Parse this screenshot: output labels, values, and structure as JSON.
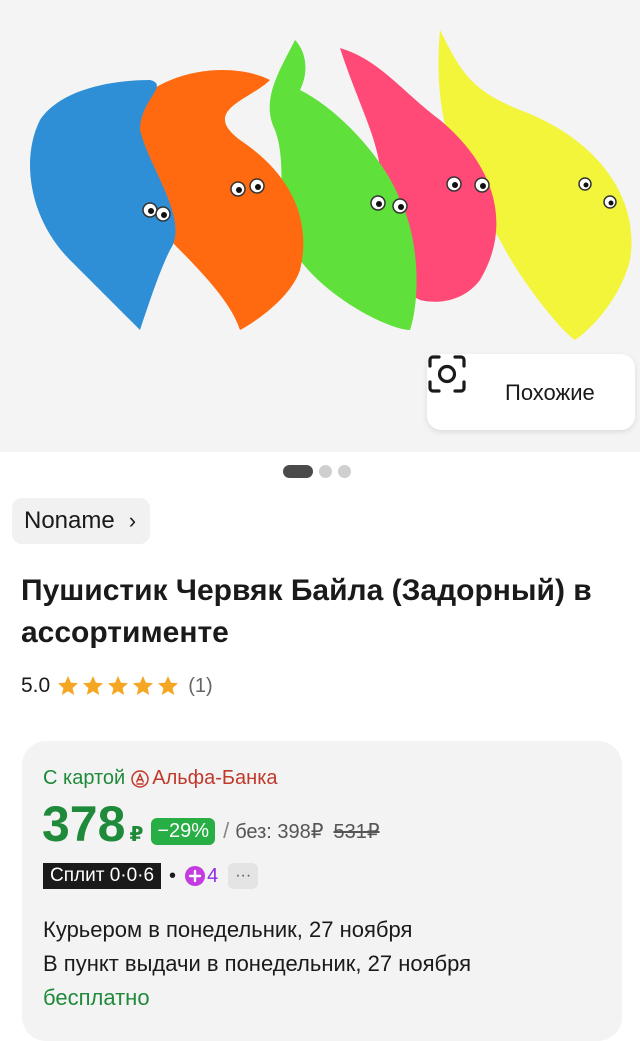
{
  "gallery": {
    "similar_label": "Похожие",
    "slides": 3,
    "active_slide": 1,
    "worm_colors": [
      "#2f8fd6",
      "#ff6a10",
      "#5fe03a",
      "#ff4a78",
      "#f2f53a"
    ]
  },
  "brand": {
    "name": "Noname"
  },
  "product": {
    "title": "Пушистик Червяк Байла (Задорный) в ассортименте",
    "rating": "5.0",
    "stars": 5,
    "reviews": "(1)"
  },
  "price_card": {
    "with_card": "С картой",
    "bank": "Альфа-Банка",
    "price": "378",
    "currency": "₽",
    "discount": "−29%",
    "without_card": "без: 398₽",
    "old_price": "531₽",
    "split": "Сплит 0·0·6",
    "plus_points": "4",
    "delivery_courier": "Курьером в понедельник, 27 ноября",
    "delivery_pickup": "В пункт выдачи в понедельник, 27 ноября",
    "free_label": "бесплатно"
  },
  "colors": {
    "green": "#1f8a3a",
    "badge_green": "#27ae45",
    "star": "#f5a623",
    "plus": "#8e2de2"
  }
}
